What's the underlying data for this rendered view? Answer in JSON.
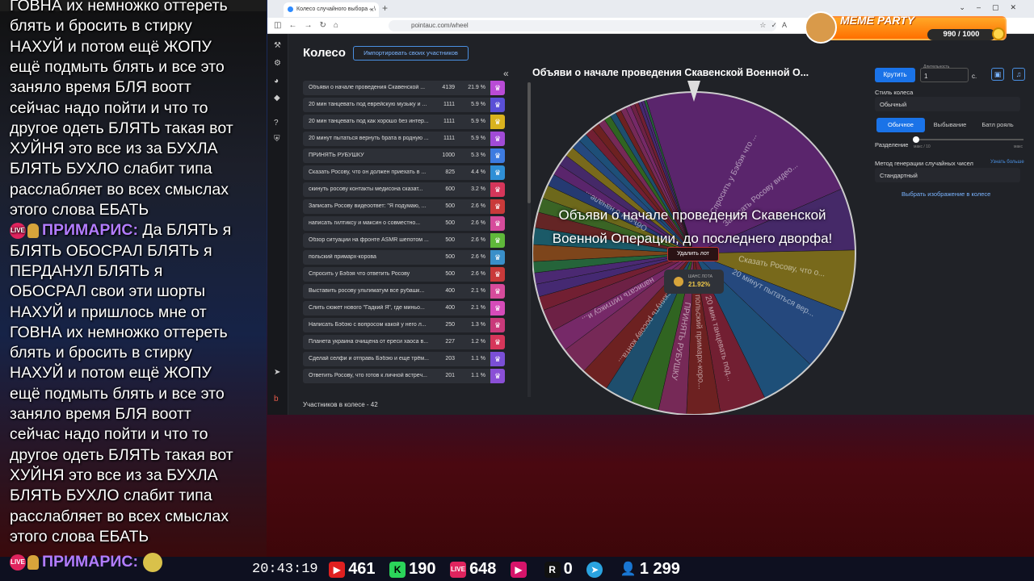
{
  "chat": {
    "lines_top": [
      "ГОВНА их немножко оттереть",
      "блять и бросить в стирку",
      "НАХУЙ и потом ещё ЖОПУ",
      "ещё подмыть блять и все это",
      "заняло время БЛЯ воотт",
      "сейчас надо пойти и что то",
      "другое одеть БЛЯТЬ такая вот",
      "ХУЙНЯ это все из за БУХЛА",
      "БЛЯТЬ БУХЛО слабит типа",
      "расслабляет во всех смыслах",
      "этого слова ЕБАТЬ"
    ],
    "author": "ПРИМАРИС:",
    "first_words": "Да БЛЯТЬ я",
    "lines_bottom": [
      "БЛЯТЬ ОБОСРАЛ БЛЯТЬ я",
      "ПЕРДАНУЛ БЛЯТЬ я",
      "ОБОСРАЛ свои эти шорты",
      "НАХУЙ и пришлось мне от",
      "ГОВНА их немножко оттереть",
      "блять и бросить в стирку",
      "НАХУЙ и потом ещё ЖОПУ",
      "ещё подмыть блять и все это",
      "заняло время БЛЯ воотт",
      "сейчас надо пойти и что то",
      "другое одеть БЛЯТЬ такая вот",
      "ХУЙНЯ это все из за БУХЛА",
      "БЛЯТЬ БУХЛО слабит типа",
      "расслабляет во всех смыслах",
      "этого слова ЕБАТЬ"
    ],
    "live_badge": "LIVE",
    "bottom_author": "ПРИМАРИС:"
  },
  "browser": {
    "tab_title": "Колесо случайного выбора – \\",
    "url": "pointauc.com/wheel"
  },
  "app": {
    "title": "Колесо",
    "import_button": "Импортировать своих участников",
    "participants_count": "Участников в колесе - 42",
    "items": [
      {
        "name": "Объяви о начале проведения Скавенской ...",
        "amount": "4139",
        "pct": "21.9 %",
        "color": "#b94bd6"
      },
      {
        "name": "20 мин танцевать под еврейскую музыку и ...",
        "amount": "1111",
        "pct": "5.9 %",
        "color": "#5a4fd6"
      },
      {
        "name": "20 мин танцевать под как хорошо без интер...",
        "amount": "1111",
        "pct": "5.9 %",
        "color": "#d9b21e"
      },
      {
        "name": "20 минут пытаться вернуть брата в родную ...",
        "amount": "1111",
        "pct": "5.9 %",
        "color": "#a14bd6"
      },
      {
        "name": "ПРИНЯТЬ РУБУШКУ",
        "amount": "1000",
        "pct": "5.3 %",
        "color": "#3d7be0"
      },
      {
        "name": "Сказать Росову, что он должен приехать в ...",
        "amount": "825",
        "pct": "4.4 %",
        "color": "#2f8fd6"
      },
      {
        "name": "скинуть росову контакты медисона сказат...",
        "amount": "600",
        "pct": "3.2 %",
        "color": "#d6365a"
      },
      {
        "name": "Записать Росову видеоответ: \"Я подумаю, ...",
        "amount": "500",
        "pct": "2.6 %",
        "color": "#c93a3a"
      },
      {
        "name": "написать гилтиксу и максин о совместно...",
        "amount": "500",
        "pct": "2.6 %",
        "color": "#d64b9b"
      },
      {
        "name": "Обзор ситуации на фронте ASMR шепотом ...",
        "amount": "500",
        "pct": "2.6 %",
        "color": "#5fb83a"
      },
      {
        "name": "польский примарх-корова",
        "amount": "500",
        "pct": "2.6 %",
        "color": "#3a8fc9"
      },
      {
        "name": "Спросить у Бэбэя что ответить Росову",
        "amount": "500",
        "pct": "2.6 %",
        "color": "#c93a3a"
      },
      {
        "name": "Выставить росову ультиматум все рубашк...",
        "amount": "400",
        "pct": "2.1 %",
        "color": "#d64b9b"
      },
      {
        "name": "Слить сюжет нового \"Гадкий Я\", где миньо...",
        "amount": "400",
        "pct": "2.1 %",
        "color": "#d64bb9"
      },
      {
        "name": "Написать Бэбэю с вопросом какой у него л...",
        "amount": "250",
        "pct": "1.3 %",
        "color": "#c93a7a"
      },
      {
        "name": "Планета украина очищена от ереси хаоса в...",
        "amount": "227",
        "pct": "1.2 %",
        "color": "#d6365a"
      },
      {
        "name": "Сделай селфи и отправь Бэбэю и еще трём...",
        "amount": "203",
        "pct": "1.1 %",
        "color": "#7a4fd6"
      },
      {
        "name": "Ответить Росову, что готов к личной встреч...",
        "amount": "201",
        "pct": "1.1 %",
        "color": "#8a4fd6"
      }
    ],
    "wheel_title": "Объяви о начале проведения Скавенской Военной О...",
    "winner_text_1": "Объяви о начале проведения Скавенской",
    "winner_text_2": "Военной Операции, до последнего дворфа!",
    "delete_button": "Удалить лот",
    "chance_label": "ШАНС ЛОТА",
    "chance_value": "21.92%",
    "wheel_labels": [
      "Сказать Росову, что о...",
      "20 минут пытаться вер...",
      "Спросить у Бэбэя что ...",
      "Записать Росову видео...",
      "20 мин танцевать под...",
      "ПРИНЯТЬ РУБУШКУ",
      "польский примарх-коро...",
      "скинуть росову конта...",
      "написать гилтиксу и...",
      "Объяви о начале..."
    ]
  },
  "controls": {
    "spin": "Крутить",
    "duration_label": "Длительность",
    "duration_value": "1",
    "duration_unit": "с.",
    "style_label": "Стиль колеса",
    "style_value": "Обычный",
    "modes": [
      "Обычное",
      "Выбывание",
      "Батл рояль"
    ],
    "split_label": "Разделение",
    "split_min": "макс / 10",
    "split_max": "макс",
    "rng_label": "Метод генерации случайных чисел",
    "rng_more": "Узнать больше",
    "rng_value": "Стандартный",
    "image_link": "Выбрать изображение в колесе"
  },
  "meme": {
    "title": "MEME PARTY",
    "progress": "990 / 1000"
  },
  "stats": {
    "clock": "20:43:19",
    "youtube": "461",
    "kick": "190",
    "live": "648",
    "r": "0",
    "viewers": "1 299"
  },
  "colors": {
    "accent": "#1a73e8",
    "purple": "#b27cff"
  }
}
